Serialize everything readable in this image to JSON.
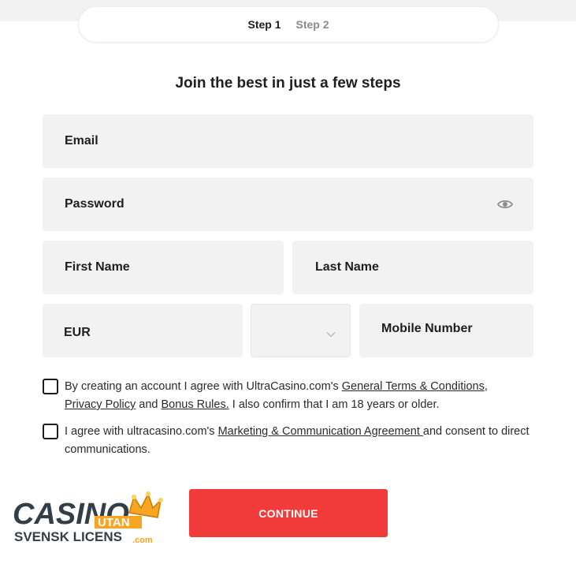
{
  "steps": {
    "step1": "Step 1",
    "step2": "Step 2"
  },
  "heading": "Join the best in just a few steps",
  "form": {
    "email_label": "Email",
    "password_label": "Password",
    "first_name_label": "First Name",
    "last_name_label": "Last Name",
    "currency_value": "EUR",
    "country_code_value": "",
    "mobile_label": "Mobile Number"
  },
  "consent": {
    "terms_prefix": "By creating an account I agree with UltraCasino.com's ",
    "terms_link": "General Terms & Conditions",
    "terms_comma": ",",
    "privacy_link": "Privacy Policy",
    "terms_and": " and ",
    "bonus_link": "Bonus Rules.",
    "terms_suffix": " I also confirm that I am 18 years or older.",
    "marketing_prefix": "I agree with ultracasino.com's ",
    "marketing_link": "Marketing & Communication Agreement ",
    "marketing_suffix": "and consent to direct communications."
  },
  "continue_label": "CONTINUE",
  "logo": {
    "word1": "CASINO",
    "word2": "UTAN",
    "word3": "SVENSK LICENS",
    "word4": ".com"
  },
  "colors": {
    "accent": "#f23c3c",
    "field_bg": "#f2f2f2",
    "text": "#1e1e1e"
  },
  "icons": {
    "password_toggle": "eye-icon",
    "dropdown": "chevron-down-icon",
    "logo_crown": "crown-icon"
  }
}
